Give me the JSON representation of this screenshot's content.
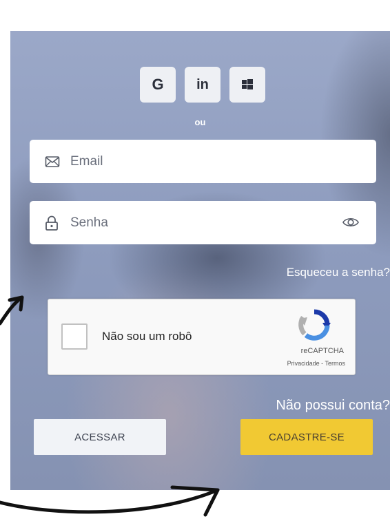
{
  "social": {
    "google_label": "G",
    "linkedin_label": "in",
    "windows_icon": "windows-icon"
  },
  "divider_text": "ou",
  "email": {
    "placeholder": "Email",
    "icon": "envelope-icon"
  },
  "password": {
    "placeholder": "Senha",
    "icon": "lock-icon",
    "toggle_icon": "eye-icon"
  },
  "forgot_link": "Esqueceu a senha?",
  "recaptcha": {
    "label": "Não sou um robô",
    "brand": "reCAPTCHA",
    "privacy": "Privacidade",
    "separator": " - ",
    "terms": "Termos"
  },
  "signup_prompt": "Não possui conta?",
  "buttons": {
    "login": "ACESSAR",
    "signup": "CADASTRE-SE"
  },
  "colors": {
    "panel_bg": "#8e9cbe",
    "signup_button": "#f1c933",
    "login_button": "#f1f3f7"
  }
}
